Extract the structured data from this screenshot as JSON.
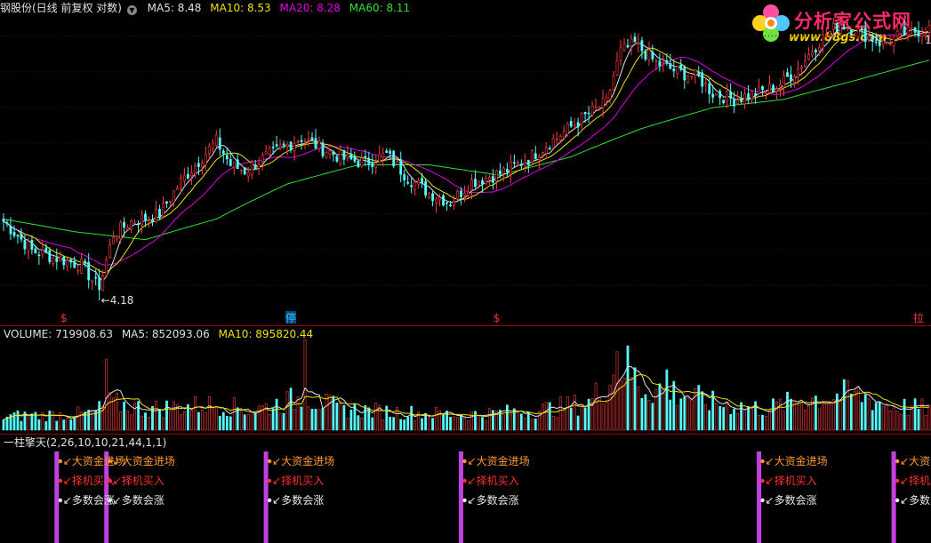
{
  "header": {
    "security": "钢股份(日线 前复权 对数)",
    "dropdown_icon": "circle-chevron-down-icon",
    "ma": [
      {
        "label": "MA5: 8.48",
        "color": "#e0e0e0"
      },
      {
        "label": "MA10: 8.53",
        "color": "#f0e000"
      },
      {
        "label": "MA20: 8.28",
        "color": "#e000e0"
      },
      {
        "label": "MA60: 8.11",
        "color": "#30e030"
      }
    ]
  },
  "logo": {
    "title": "分析家公式网",
    "url": "www.88gs.com",
    "icon": "flower-logo-icon"
  },
  "price_panel": {
    "low_label": "←4.18",
    "markers": [
      {
        "text": "$",
        "color": "#ff3030",
        "x_index": 17
      },
      {
        "text": "停",
        "color": "#30c0ff",
        "x_index": 81,
        "boxed": true
      },
      {
        "text": "$",
        "color": "#ff3030",
        "x_index": 139
      },
      {
        "text": "拉",
        "color": "#ff3030",
        "x_index": 258
      }
    ],
    "top_right_mark": "1"
  },
  "volume_panel": {
    "header": [
      {
        "label": "VOLUME: 719908.63",
        "color": "#e0e0e0"
      },
      {
        "label": "MA5: 852093.06",
        "color": "#e0e0e0"
      },
      {
        "label": "MA10: 895820.44",
        "color": "#f0e000"
      }
    ]
  },
  "indicator_panel": {
    "title": "一柱擎天(2,26,10,10,21,44,1,1)",
    "labels": {
      "big_money": "↙大资金进场",
      "buy": "↙择机买入",
      "rise": "↙多数会涨"
    },
    "colors": {
      "big_money": "#ff9a2a",
      "buy": "#ff3030",
      "rise": "#e8e8e8",
      "bar": "#c040e0"
    },
    "signals": [
      {
        "x_index": 15
      },
      {
        "x_index": 29
      },
      {
        "x_index": 74
      },
      {
        "x_index": 129
      },
      {
        "x_index": 213
      },
      {
        "x_index": 251
      }
    ]
  },
  "chart_data": {
    "type": "candlestick",
    "log_scale": true,
    "bar_count": 262,
    "price_range": [
      4.0,
      11.6
    ],
    "low_point": {
      "x_index": 27,
      "value": 4.18
    },
    "close_anchors": [
      [
        0,
        5.55
      ],
      [
        8,
        5.0
      ],
      [
        16,
        4.85
      ],
      [
        22,
        4.75
      ],
      [
        27,
        4.35
      ],
      [
        31,
        5.3
      ],
      [
        36,
        5.55
      ],
      [
        44,
        5.7
      ],
      [
        50,
        6.4
      ],
      [
        56,
        7.0
      ],
      [
        60,
        7.4
      ],
      [
        64,
        6.8
      ],
      [
        68,
        6.65
      ],
      [
        72,
        6.9
      ],
      [
        78,
        7.2
      ],
      [
        84,
        7.5
      ],
      [
        90,
        7.2
      ],
      [
        96,
        6.95
      ],
      [
        102,
        6.85
      ],
      [
        108,
        7.05
      ],
      [
        114,
        6.5
      ],
      [
        120,
        6.15
      ],
      [
        126,
        5.95
      ],
      [
        132,
        6.4
      ],
      [
        140,
        6.6
      ],
      [
        148,
        6.95
      ],
      [
        156,
        7.5
      ],
      [
        164,
        8.1
      ],
      [
        170,
        8.5
      ],
      [
        174,
        10.2
      ],
      [
        178,
        10.5
      ],
      [
        184,
        9.8
      ],
      [
        190,
        9.5
      ],
      [
        196,
        9.3
      ],
      [
        200,
        8.8
      ],
      [
        206,
        8.6
      ],
      [
        212,
        8.8
      ],
      [
        218,
        9.0
      ],
      [
        224,
        9.6
      ],
      [
        230,
        10.6
      ],
      [
        236,
        11.3
      ],
      [
        242,
        10.9
      ],
      [
        248,
        10.5
      ],
      [
        254,
        10.9
      ],
      [
        261,
        11.1
      ]
    ],
    "ma60_anchors": [
      [
        0,
        5.6
      ],
      [
        20,
        5.35
      ],
      [
        40,
        5.2
      ],
      [
        60,
        5.6
      ],
      [
        80,
        6.35
      ],
      [
        100,
        6.8
      ],
      [
        120,
        6.8
      ],
      [
        140,
        6.55
      ],
      [
        160,
        7.0
      ],
      [
        180,
        7.75
      ],
      [
        200,
        8.35
      ],
      [
        220,
        8.6
      ],
      [
        240,
        9.2
      ],
      [
        261,
        9.9
      ]
    ],
    "volume_range": [
      0,
      3000000
    ],
    "volume_anchors": [
      [
        0,
        450000
      ],
      [
        25,
        550000
      ],
      [
        30,
        900000
      ],
      [
        40,
        700000
      ],
      [
        60,
        850000
      ],
      [
        70,
        650000
      ],
      [
        85,
        1100000
      ],
      [
        95,
        700000
      ],
      [
        110,
        600000
      ],
      [
        130,
        500000
      ],
      [
        150,
        650000
      ],
      [
        165,
        900000
      ],
      [
        175,
        2200000
      ],
      [
        180,
        1400000
      ],
      [
        188,
        1300000
      ],
      [
        200,
        900000
      ],
      [
        215,
        700000
      ],
      [
        225,
        1000000
      ],
      [
        240,
        1200000
      ],
      [
        250,
        800000
      ],
      [
        261,
        700000
      ]
    ],
    "volume_spikes": [
      {
        "x_index": 29,
        "value": 2350000
      },
      {
        "x_index": 85,
        "value": 3000000
      },
      {
        "x_index": 173,
        "value": 2600000
      },
      {
        "x_index": 187,
        "value": 2000000
      }
    ]
  }
}
